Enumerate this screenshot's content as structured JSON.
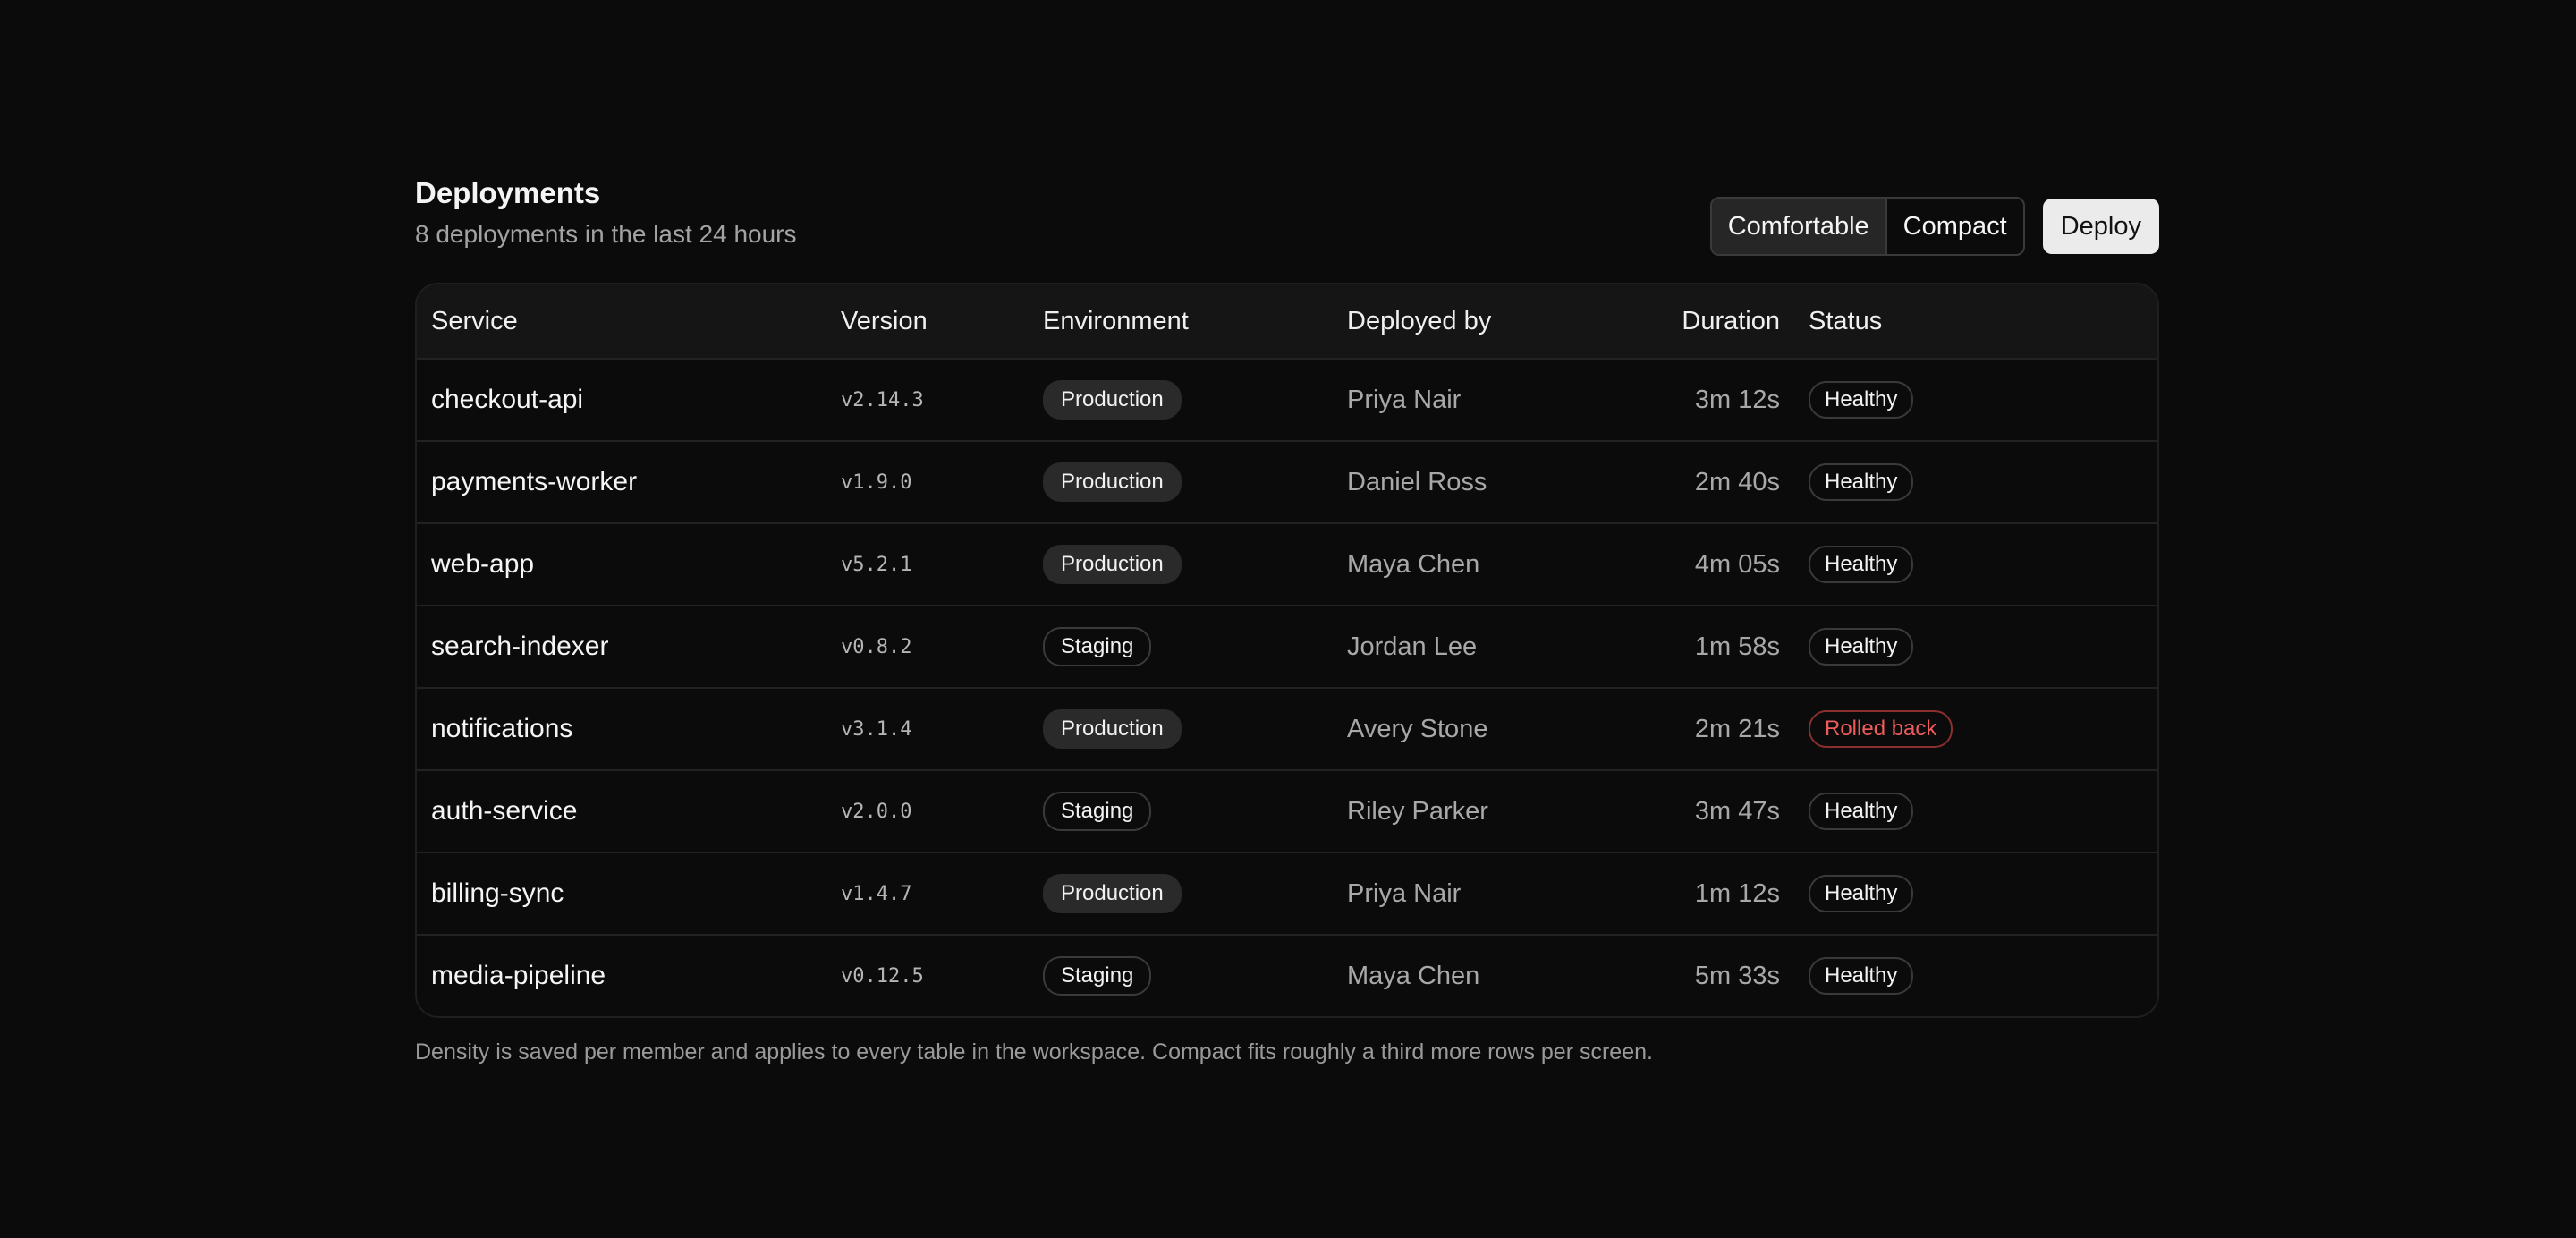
{
  "header": {
    "title": "Deployments",
    "subtitle": "8 deployments in the last 24 hours"
  },
  "density_toggle": {
    "options": [
      "Comfortable",
      "Compact"
    ],
    "selected": "Comfortable"
  },
  "deploy_button": {
    "label": "Deploy"
  },
  "table": {
    "columns": {
      "service": "Service",
      "version": "Version",
      "environment": "Environment",
      "deployed_by": "Deployed by",
      "duration": "Duration",
      "status": "Status"
    },
    "rows": [
      {
        "service": "checkout-api",
        "version": "v2.14.3",
        "environment": "Production",
        "deployed_by": "Priya Nair",
        "duration": "3m 12s",
        "status": "Healthy"
      },
      {
        "service": "payments-worker",
        "version": "v1.9.0",
        "environment": "Production",
        "deployed_by": "Daniel Ross",
        "duration": "2m 40s",
        "status": "Healthy"
      },
      {
        "service": "web-app",
        "version": "v5.2.1",
        "environment": "Production",
        "deployed_by": "Maya Chen",
        "duration": "4m 05s",
        "status": "Healthy"
      },
      {
        "service": "search-indexer",
        "version": "v0.8.2",
        "environment": "Staging",
        "deployed_by": "Jordan Lee",
        "duration": "1m 58s",
        "status": "Healthy"
      },
      {
        "service": "notifications",
        "version": "v3.1.4",
        "environment": "Production",
        "deployed_by": "Avery Stone",
        "duration": "2m 21s",
        "status": "Rolled back"
      },
      {
        "service": "auth-service",
        "version": "v2.0.0",
        "environment": "Staging",
        "deployed_by": "Riley Parker",
        "duration": "3m 47s",
        "status": "Healthy"
      },
      {
        "service": "billing-sync",
        "version": "v1.4.7",
        "environment": "Production",
        "deployed_by": "Priya Nair",
        "duration": "1m 12s",
        "status": "Healthy"
      },
      {
        "service": "media-pipeline",
        "version": "v0.12.5",
        "environment": "Staging",
        "deployed_by": "Maya Chen",
        "duration": "5m 33s",
        "status": "Healthy"
      }
    ]
  },
  "footnote": "Density is saved per member and applies to every table in the workspace. Compact fits roughly a third more rows per screen.",
  "colors": {
    "background": "#0b0b0b",
    "rolled_back": "#ef5c5c",
    "deploy_button_bg": "#ebebeb"
  }
}
